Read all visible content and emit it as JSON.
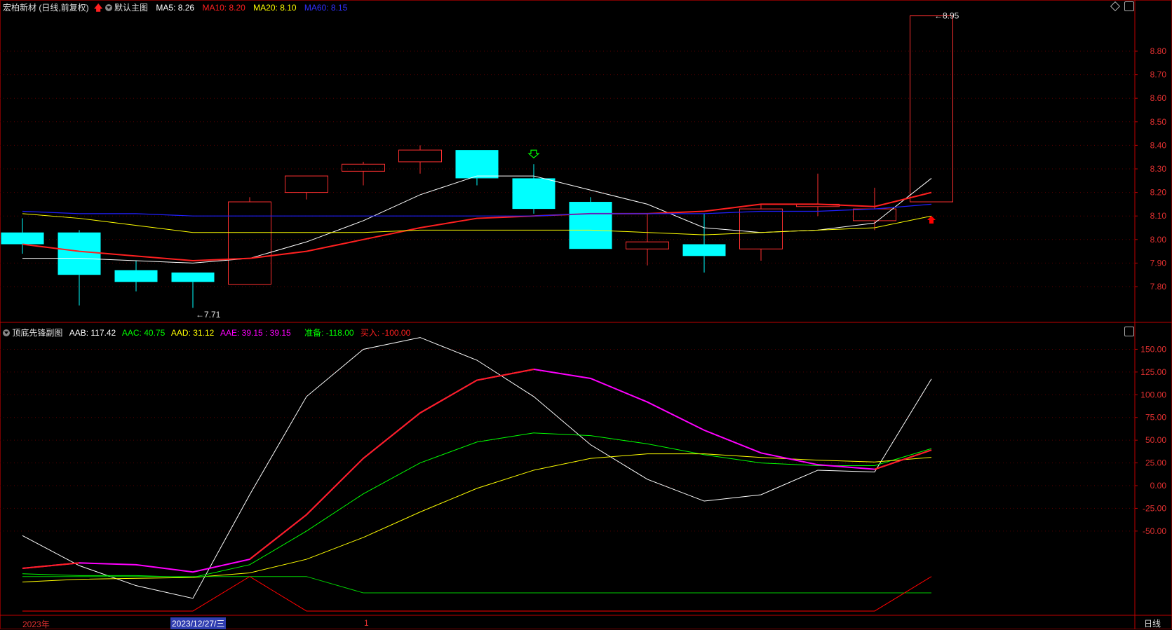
{
  "main_header": {
    "stock_name": "宏柏新材 (日线,前复权)",
    "main_chart_label": "默认主图",
    "ma5_label": "MA5: 8.26",
    "ma10_label": "MA10: 8.20",
    "ma20_label": "MA20: 8.10",
    "ma60_label": "MA60: 8.15"
  },
  "sub_header": {
    "indicator_name": "顶底先锋副图",
    "aab_label": "AAB: 117.42",
    "aac_label": "AAC: 40.75",
    "aad_label": "AAD: 31.12",
    "aae_label": "AAE: 39.15 : 39.15",
    "prep_label": "准备: -118.00",
    "buy_label": "买入: -100.00"
  },
  "footer": {
    "year": "2023年",
    "date": "2023/12/27/三",
    "mid_tick": "1",
    "period": "日线"
  },
  "colors": {
    "background": "#000000",
    "grid": "#5a0000",
    "axis_text": "#e03030",
    "up": "#ff3030",
    "down": "#00ffff",
    "ma5": "#ffffff",
    "ma10": "#ff2020",
    "ma20": "#ffff00",
    "ma60": "#2020ff",
    "aab": "#ffffff",
    "aac": "#00ff00",
    "aad": "#ffff00",
    "aae": "#ff00ff",
    "prep": "#00cc00",
    "buy": "#ff0000"
  },
  "chart_data": [
    {
      "type": "candlestick",
      "title": "宏柏新材 (日线,前复权)",
      "ylim": [
        7.64,
        9.0
      ],
      "yticks": [
        7.8,
        7.9,
        8.0,
        8.1,
        8.2,
        8.3,
        8.4,
        8.5,
        8.6,
        8.7,
        8.8
      ],
      "ytick_labels": [
        "7.80",
        "7.90",
        "8.00",
        "8.10",
        "8.20",
        "8.30",
        "8.40",
        "8.50",
        "8.60",
        "8.70",
        "8.80"
      ],
      "candles": [
        {
          "open": 8.03,
          "close": 7.98,
          "high": 8.09,
          "low": 7.94
        },
        {
          "open": 8.03,
          "close": 7.85,
          "high": 8.04,
          "low": 7.72
        },
        {
          "open": 7.87,
          "close": 7.82,
          "high": 7.91,
          "low": 7.78
        },
        {
          "open": 7.86,
          "close": 7.82,
          "high": 7.86,
          "low": 7.71
        },
        {
          "open": 7.81,
          "close": 8.16,
          "high": 8.18,
          "low": 7.81
        },
        {
          "open": 8.2,
          "close": 8.27,
          "high": 8.27,
          "low": 8.17
        },
        {
          "open": 8.29,
          "close": 8.32,
          "high": 8.33,
          "low": 8.23
        },
        {
          "open": 8.33,
          "close": 8.38,
          "high": 8.4,
          "low": 8.28
        },
        {
          "open": 8.38,
          "close": 8.26,
          "high": 8.38,
          "low": 8.23
        },
        {
          "open": 8.26,
          "close": 8.13,
          "high": 8.32,
          "low": 8.11
        },
        {
          "open": 8.16,
          "close": 7.96,
          "high": 8.18,
          "low": 7.96
        },
        {
          "open": 7.96,
          "close": 7.99,
          "high": 8.11,
          "low": 7.89
        },
        {
          "open": 7.98,
          "close": 7.93,
          "high": 8.11,
          "low": 7.86
        },
        {
          "open": 7.96,
          "close": 8.13,
          "high": 8.15,
          "low": 7.91
        },
        {
          "open": 8.14,
          "close": 8.15,
          "high": 8.28,
          "low": 8.1
        },
        {
          "open": 8.08,
          "close": 8.13,
          "high": 8.22,
          "low": 8.04
        },
        {
          "open": 8.16,
          "close": 8.95,
          "high": 8.95,
          "low": 8.16
        }
      ],
      "series": [
        {
          "name": "MA5",
          "values": [
            7.92,
            7.92,
            7.91,
            7.9,
            7.92,
            7.99,
            8.08,
            8.19,
            8.27,
            8.27,
            8.21,
            8.15,
            8.05,
            8.03,
            8.04,
            8.07,
            8.26
          ]
        },
        {
          "name": "MA10",
          "values": [
            7.98,
            7.95,
            7.93,
            7.91,
            7.92,
            7.95,
            8.0,
            8.05,
            8.09,
            8.1,
            8.11,
            8.11,
            8.12,
            8.15,
            8.15,
            8.14,
            8.2
          ]
        },
        {
          "name": "MA20",
          "values": [
            8.11,
            8.09,
            8.06,
            8.03,
            8.03,
            8.03,
            8.03,
            8.04,
            8.04,
            8.04,
            8.04,
            8.03,
            8.02,
            8.03,
            8.04,
            8.05,
            8.1
          ]
        },
        {
          "name": "MA60",
          "values": [
            8.12,
            8.11,
            8.11,
            8.1,
            8.1,
            8.1,
            8.1,
            8.1,
            8.1,
            8.1,
            8.11,
            8.11,
            8.11,
            8.12,
            8.12,
            8.13,
            8.15
          ]
        }
      ],
      "annotations": [
        {
          "text": "7.71",
          "candle": 3,
          "value": 7.71
        },
        {
          "text": "8.95",
          "candle": 16,
          "value": 8.95
        }
      ],
      "signals": [
        {
          "candle": 9,
          "type": "sell",
          "color": "#00ff00"
        },
        {
          "candle": 16,
          "type": "buy",
          "color": "#ff0000"
        }
      ]
    },
    {
      "type": "line",
      "title": "顶底先锋副图",
      "ylim": [
        -140,
        170
      ],
      "yticks": [
        150,
        125,
        100,
        75,
        50,
        25,
        0,
        -25,
        -50
      ],
      "ytick_labels": [
        "150.00",
        "125.00",
        "100.00",
        "75.00",
        "50.00",
        "25.00",
        "0.00",
        "-25.00",
        "-50.00"
      ],
      "series": [
        {
          "name": "AAB",
          "values": [
            -55,
            -88,
            -110,
            -124,
            -10,
            98,
            150,
            163,
            138,
            98,
            45,
            7,
            -17,
            -10,
            17,
            15,
            117.42
          ]
        },
        {
          "name": "AAC",
          "values": [
            -97,
            -99,
            -99,
            -101,
            -87,
            -50,
            -9,
            25,
            48,
            58,
            55,
            46,
            34,
            25,
            22,
            22,
            40.75
          ]
        },
        {
          "name": "AAD",
          "values": [
            -106,
            -103,
            -102,
            -101,
            -96,
            -81,
            -57,
            -29,
            -3,
            17,
            30,
            35,
            35,
            31,
            28,
            26,
            31.12
          ]
        },
        {
          "name": "AAE",
          "values": [
            -91,
            -85,
            -87,
            -95,
            -81,
            -32,
            30,
            80,
            116,
            128,
            118,
            92,
            61,
            36,
            23,
            18,
            39.15
          ]
        },
        {
          "name": "准备",
          "values": [
            -100,
            -100,
            -100,
            -100,
            -100,
            -100,
            -118,
            -118,
            -118,
            -118,
            -118,
            -118,
            -118,
            -118,
            -118,
            -118,
            -118
          ]
        },
        {
          "name": "买入",
          "values": [
            -138,
            -138,
            -138,
            -138,
            -100,
            -138,
            -138,
            -138,
            -138,
            -138,
            -138,
            -138,
            -138,
            -138,
            -138,
            -138,
            -100
          ]
        }
      ]
    }
  ]
}
